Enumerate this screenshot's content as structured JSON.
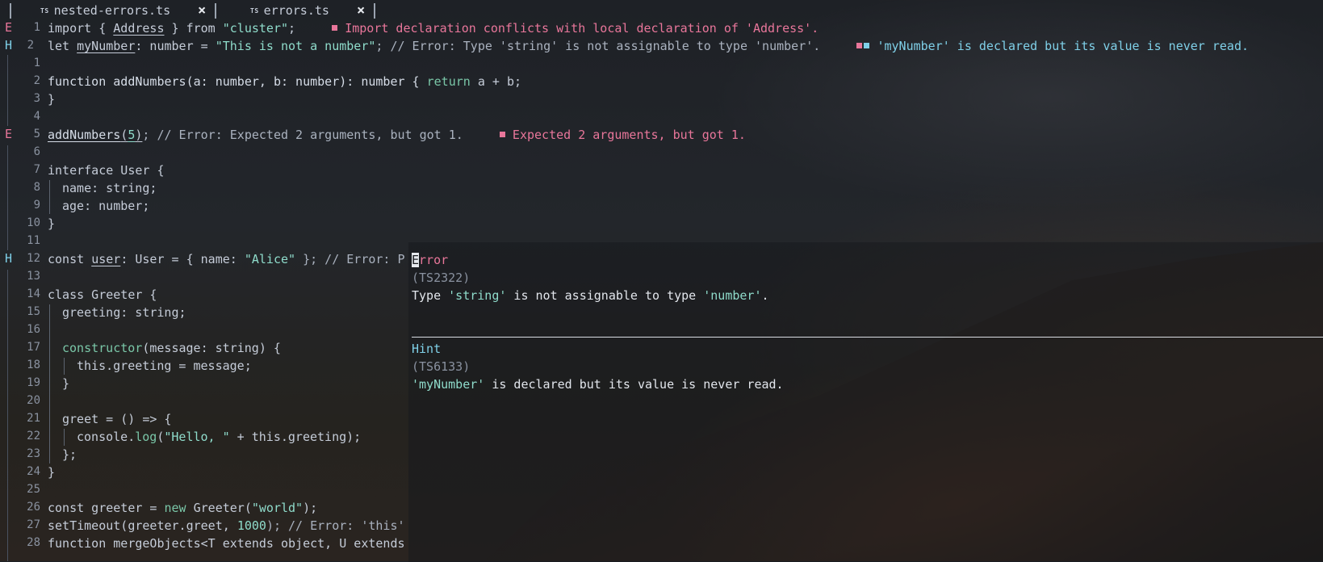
{
  "tabs": [
    {
      "icon": "TS",
      "label": "nested-errors.ts",
      "close": "×"
    },
    {
      "icon": "TS",
      "label": "errors.ts",
      "close": "×"
    }
  ],
  "gutter": {
    "error_mark": "E",
    "hint_mark": "H",
    "line_numbers": [
      "1",
      "2",
      "1",
      "2",
      "3",
      "4",
      "5",
      "6",
      "7",
      "8",
      "9",
      "10",
      "11",
      "12",
      "13",
      "14",
      "15",
      "16",
      "17",
      "18",
      "19",
      "20",
      "21",
      "22",
      "23",
      "24",
      "25",
      "26",
      "27",
      "28"
    ]
  },
  "code": {
    "l1_import": "import",
    "l1_brace_open": "{",
    "l1_address": "Address",
    "l1_rest": "} from ",
    "l1_module": "\"cluster\"",
    "l1_semi": ";",
    "l1_diag": "Import declaration conflicts with local declaration of 'Address'.",
    "l2_let": "let ",
    "l2_var": "myNumber",
    "l2_type": ": number = ",
    "l2_str": "\"This is not a number\"",
    "l2_comment": "; // Error: Type 'string' is not assignable to type 'number'.",
    "l2_diag": "'myNumber' is declared but its value is never read.",
    "l4_a": "function addNumbers(a: number, b: number): number { ",
    "l4_return": "return",
    "l4_b": " a + b;",
    "l5": "}",
    "l7_fn": "addNumbers",
    "l7_open": "(",
    "l7_num": "5",
    "l7_close": ")",
    "l7_comment": "; // Error: Expected 2 arguments, but got 1.",
    "l7_diag": "Expected 2 arguments, but got 1.",
    "l9": "interface User {",
    "l10": "name: string;",
    "l11": "age: number;",
    "l12": "}",
    "l14_a": "const ",
    "l14_var": "user",
    "l14_b": ": User = { name: ",
    "l14_str": "\"Alice\"",
    "l14_c": " }; // Error: P",
    "l16": "class Greeter {",
    "l17": "greeting: string;",
    "l19_ctor": "constructor",
    "l19_rest": "(message: string) {",
    "l20": "this.greeting = message;",
    "l21": "}",
    "l23": "greet = () => {",
    "l24_a": "console.",
    "l24_log": "log",
    "l24_b": "(",
    "l24_str": "\"Hello, \"",
    "l24_c": " + this.greeting);",
    "l25": "};",
    "l26": "}",
    "l28_a": "const greeter = ",
    "l28_new": "new",
    "l28_b": " Greeter(",
    "l28_str": "\"world\"",
    "l28_c": ");",
    "l29_a": "setTimeout(greeter.greet, ",
    "l29_num": "1000",
    "l29_b": "); // Error: 'this'",
    "l30": "function mergeObjects<T extends object, U extends"
  },
  "hover_popup": {
    "error": {
      "cursor_char": "E",
      "title_rest": "rror",
      "code": "(TS2322)",
      "msg_a": "Type ",
      "msg_q1": "'string'",
      "msg_b": " is not assignable to type ",
      "msg_q2": "'number'",
      "msg_c": "."
    },
    "hint": {
      "title": "Hint",
      "code": "(TS6133)",
      "msg_q": "'myNumber'",
      "msg_rest": " is declared but its value is never read."
    }
  },
  "colors": {
    "error": "#e8769a",
    "hint": "#7fd0e8",
    "string": "#8fdccb",
    "text": "#c5ccd8"
  }
}
